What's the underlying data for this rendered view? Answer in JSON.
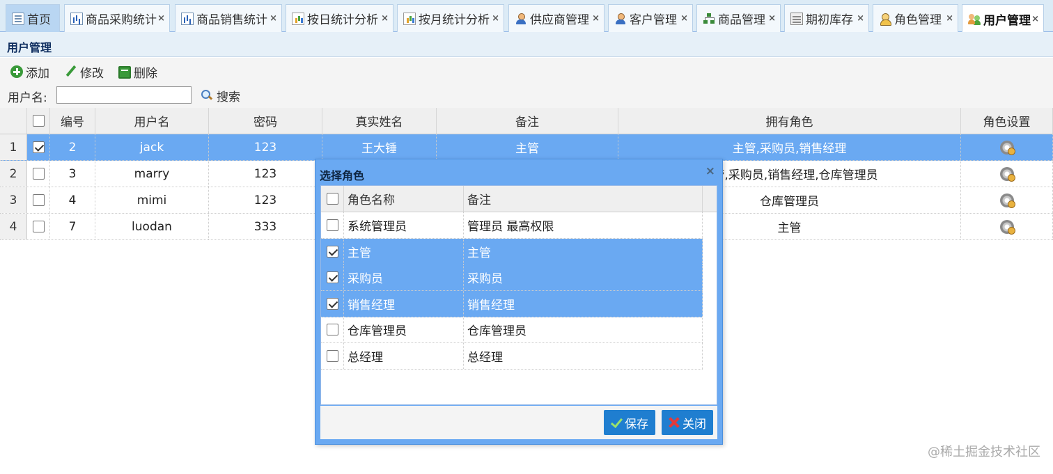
{
  "tabs": [
    {
      "label": "首页",
      "icon": "page-icon",
      "closable": false
    },
    {
      "label": "商品采购统计",
      "icon": "bar-chart-icon",
      "closable": true
    },
    {
      "label": "商品销售统计",
      "icon": "bar-chart-icon",
      "closable": true
    },
    {
      "label": "按日统计分析",
      "icon": "report-icon",
      "closable": true
    },
    {
      "label": "按月统计分析",
      "icon": "report-icon",
      "closable": true
    },
    {
      "label": "供应商管理",
      "icon": "user-icon",
      "closable": true
    },
    {
      "label": "客户管理",
      "icon": "user-icon",
      "closable": true
    },
    {
      "label": "商品管理",
      "icon": "sitemap-icon",
      "closable": true
    },
    {
      "label": "期初库存",
      "icon": "inventory-icon",
      "closable": true
    },
    {
      "label": "角色管理",
      "icon": "role-icon",
      "closable": true
    },
    {
      "label": "用户管理",
      "icon": "users-icon",
      "closable": true,
      "active": true
    }
  ],
  "tab_close_glyph": "×",
  "panel": {
    "title": "用户管理"
  },
  "toolbar": {
    "add_label": "添加",
    "edit_label": "修改",
    "delete_label": "删除",
    "search_label": "用户名:",
    "search_value": "",
    "search_button": "搜索"
  },
  "grid": {
    "columns": [
      "编号",
      "用户名",
      "密码",
      "真实姓名",
      "备注",
      "拥有角色",
      "角色设置"
    ],
    "rows": [
      {
        "num": "1",
        "checked": true,
        "selected": true,
        "id": "2",
        "username": "jack",
        "password": "123",
        "realname": "王大锤",
        "remark": "主管",
        "roles": "主管,采购员,销售经理"
      },
      {
        "num": "2",
        "checked": false,
        "selected": false,
        "id": "3",
        "username": "marry",
        "password": "123",
        "realname": "",
        "remark": "",
        "roles": "主管,采购员,销售经理,仓库管理员"
      },
      {
        "num": "3",
        "checked": false,
        "selected": false,
        "id": "4",
        "username": "mimi",
        "password": "123",
        "realname": "",
        "remark": "",
        "roles": "仓库管理员"
      },
      {
        "num": "4",
        "checked": false,
        "selected": false,
        "id": "7",
        "username": "luodan",
        "password": "333",
        "realname": "",
        "remark": "",
        "roles": "主管"
      }
    ]
  },
  "dialog": {
    "title": "选择角色",
    "close_glyph": "×",
    "columns": [
      "角色名称",
      "备注"
    ],
    "rows": [
      {
        "name": "系统管理员",
        "remark": "管理员 最高权限",
        "checked": false
      },
      {
        "name": "主管",
        "remark": "主管",
        "checked": true
      },
      {
        "name": "采购员",
        "remark": "采购员",
        "checked": true
      },
      {
        "name": "销售经理",
        "remark": "销售经理",
        "checked": true
      },
      {
        "name": "仓库管理员",
        "remark": "仓库管理员",
        "checked": false
      },
      {
        "name": "总经理",
        "remark": "总经理",
        "checked": false
      }
    ],
    "save_label": "保存",
    "close_label": "关闭"
  },
  "watermark": "@稀土掘金技术社区",
  "colors": {
    "selection": "#6aa9f2",
    "header_bar": "#dcebf6",
    "dialog_button": "#1f7ed0"
  }
}
